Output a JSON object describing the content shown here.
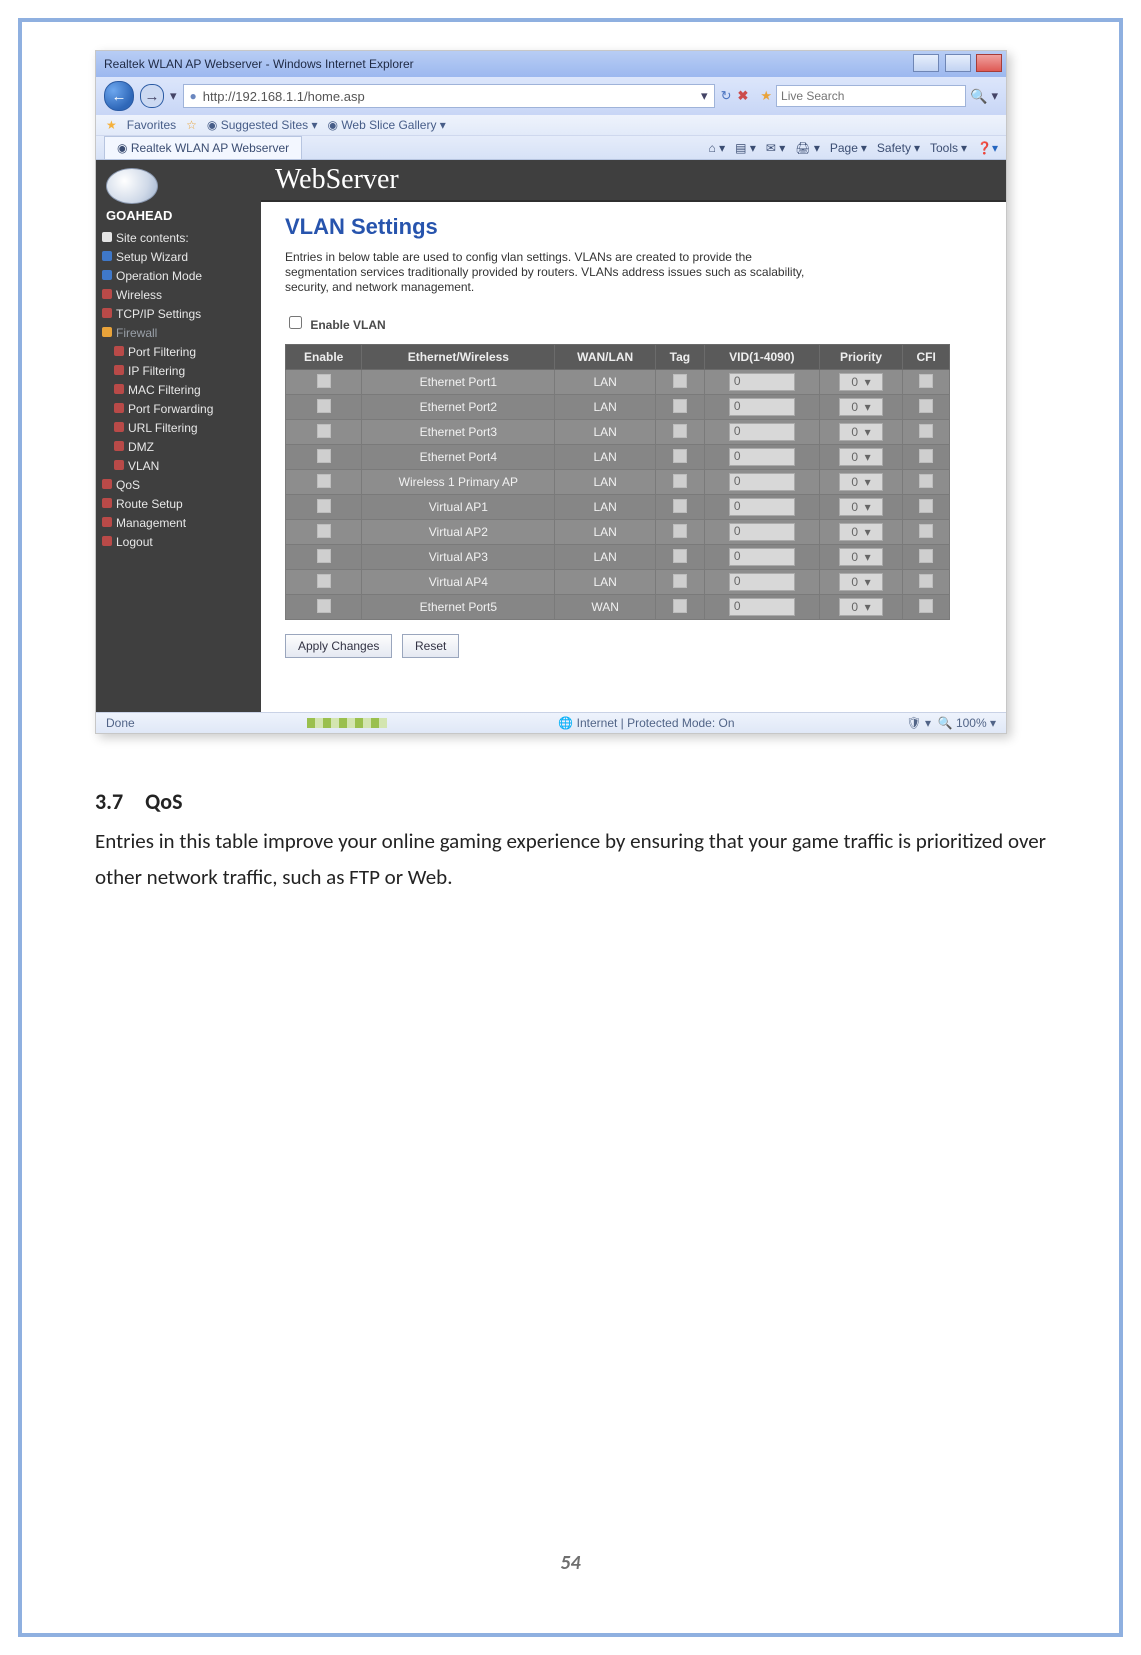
{
  "window": {
    "title": "Realtek WLAN AP Webserver - Windows Internet Explorer",
    "url": "http://192.168.1.1/home.asp",
    "tab_label": "Realtek WLAN AP Webserver",
    "search_placeholder": "Live Search",
    "favorites": "Favorites",
    "suggested": "Suggested Sites",
    "gallery": "Web Slice Gallery",
    "tool_page": "Page",
    "tool_safety": "Safety",
    "tool_tools": "Tools",
    "status_done": "Done",
    "status_zone": "Internet | Protected Mode: On",
    "status_zoom": "100%"
  },
  "sidebar": {
    "brand": "GOAHEAD",
    "site_contents": "Site contents:",
    "items": [
      "Setup Wizard",
      "Operation Mode",
      "Wireless",
      "TCP/IP Settings",
      "Firewall",
      "Port Filtering",
      "IP Filtering",
      "MAC Filtering",
      "Port Forwarding",
      "URL Filtering",
      "DMZ",
      "VLAN",
      "QoS",
      "Route Setup",
      "Management",
      "Logout"
    ]
  },
  "main": {
    "webserver": "WebServer",
    "title": "VLAN Settings",
    "desc": "Entries in below table are used to config vlan settings. VLANs are created to provide the segmentation services traditionally provided by routers. VLANs address issues such as scalability, security, and network management.",
    "enable_vlan": "Enable VLAN",
    "cols": {
      "enable": "Enable",
      "eth": "Ethernet/Wireless",
      "wan": "WAN/LAN",
      "tag": "Tag",
      "vid": "VID(1-4090)",
      "prio": "Priority",
      "cfi": "CFI"
    },
    "rows": [
      {
        "name": "Ethernet Port1",
        "wan": "LAN",
        "vid": "0",
        "prio": "0"
      },
      {
        "name": "Ethernet Port2",
        "wan": "LAN",
        "vid": "0",
        "prio": "0"
      },
      {
        "name": "Ethernet Port3",
        "wan": "LAN",
        "vid": "0",
        "prio": "0"
      },
      {
        "name": "Ethernet Port4",
        "wan": "LAN",
        "vid": "0",
        "prio": "0"
      },
      {
        "name": "Wireless 1 Primary AP",
        "wan": "LAN",
        "vid": "0",
        "prio": "0"
      },
      {
        "name": "Virtual AP1",
        "wan": "LAN",
        "vid": "0",
        "prio": "0"
      },
      {
        "name": "Virtual AP2",
        "wan": "LAN",
        "vid": "0",
        "prio": "0"
      },
      {
        "name": "Virtual AP3",
        "wan": "LAN",
        "vid": "0",
        "prio": "0"
      },
      {
        "name": "Virtual AP4",
        "wan": "LAN",
        "vid": "0",
        "prio": "0"
      },
      {
        "name": "Ethernet Port5",
        "wan": "WAN",
        "vid": "0",
        "prio": "0"
      }
    ],
    "btn_apply": "Apply Changes",
    "btn_reset": "Reset"
  },
  "doc": {
    "heading": "3.7 QoS",
    "para": "Entries in this table improve your online gaming experience by ensuring that your game traffic is prioritized over other network traffic, such as FTP or Web.",
    "page": "54"
  }
}
